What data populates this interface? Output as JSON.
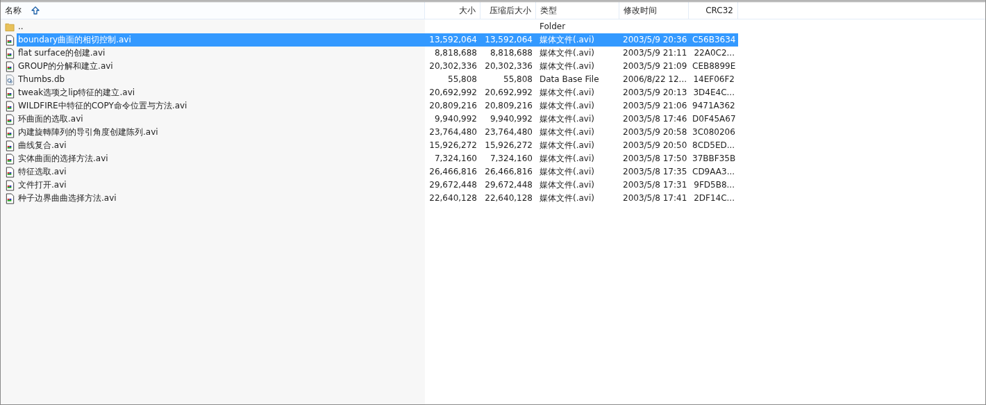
{
  "columns": [
    {
      "label": "名称",
      "sorted": true
    },
    {
      "label": "大小",
      "sorted": false
    },
    {
      "label": "压缩后大小",
      "sorted": false
    },
    {
      "label": "类型",
      "sorted": false
    },
    {
      "label": "修改时间",
      "sorted": false
    },
    {
      "label": "CRC32",
      "sorted": false
    }
  ],
  "rows": [
    {
      "kind": "folder",
      "selected": false,
      "name": "..",
      "size": "",
      "packed": "",
      "type": "Folder",
      "modified": "",
      "crc": ""
    },
    {
      "kind": "video",
      "selected": true,
      "name": "boundary曲面的相切控制.avi",
      "size": "13,592,064",
      "packed": "13,592,064",
      "type": "媒体文件(.avi)",
      "modified": "2003/5/9 20:36",
      "crc": "C56B3634"
    },
    {
      "kind": "video",
      "selected": false,
      "name": "flat surface的创建.avi",
      "size": "8,818,688",
      "packed": "8,818,688",
      "type": "媒体文件(.avi)",
      "modified": "2003/5/9 21:11",
      "crc": "22A0C2..."
    },
    {
      "kind": "video",
      "selected": false,
      "name": "GROUP的分解和建立.avi",
      "size": "20,302,336",
      "packed": "20,302,336",
      "type": "媒体文件(.avi)",
      "modified": "2003/5/9 21:09",
      "crc": "CEB8899E"
    },
    {
      "kind": "database",
      "selected": false,
      "name": "Thumbs.db",
      "size": "55,808",
      "packed": "55,808",
      "type": "Data Base File",
      "modified": "2006/8/22 12...",
      "crc": "14EF06F2"
    },
    {
      "kind": "video",
      "selected": false,
      "name": "tweak选项之lip特征的建立.avi",
      "size": "20,692,992",
      "packed": "20,692,992",
      "type": "媒体文件(.avi)",
      "modified": "2003/5/9 20:13",
      "crc": "3D4E4C..."
    },
    {
      "kind": "video",
      "selected": false,
      "name": "WILDFIRE中特征的COPY命令位置与方法.avi",
      "size": "20,809,216",
      "packed": "20,809,216",
      "type": "媒体文件(.avi)",
      "modified": "2003/5/9 21:06",
      "crc": "9471A362"
    },
    {
      "kind": "video",
      "selected": false,
      "name": "环曲面的选取.avi",
      "size": "9,940,992",
      "packed": "9,940,992",
      "type": "媒体文件(.avi)",
      "modified": "2003/5/8 17:46",
      "crc": "D0F45A67"
    },
    {
      "kind": "video",
      "selected": false,
      "name": "内建旋轉陣列的导引角度创建陈列.avi",
      "size": "23,764,480",
      "packed": "23,764,480",
      "type": "媒体文件(.avi)",
      "modified": "2003/5/9 20:58",
      "crc": "3C080206"
    },
    {
      "kind": "video",
      "selected": false,
      "name": "曲线复合.avi",
      "size": "15,926,272",
      "packed": "15,926,272",
      "type": "媒体文件(.avi)",
      "modified": "2003/5/9 20:50",
      "crc": "8CD5ED..."
    },
    {
      "kind": "video",
      "selected": false,
      "name": "实体曲面的选择方法.avi",
      "size": "7,324,160",
      "packed": "7,324,160",
      "type": "媒体文件(.avi)",
      "modified": "2003/5/8 17:50",
      "crc": "37BBF35B"
    },
    {
      "kind": "video",
      "selected": false,
      "name": "特征选取.avi",
      "size": "26,466,816",
      "packed": "26,466,816",
      "type": "媒体文件(.avi)",
      "modified": "2003/5/8 17:35",
      "crc": "CD9AA3..."
    },
    {
      "kind": "video",
      "selected": false,
      "name": "文件打开.avi",
      "size": "29,672,448",
      "packed": "29,672,448",
      "type": "媒体文件(.avi)",
      "modified": "2003/5/8 17:31",
      "crc": "9FD5B8..."
    },
    {
      "kind": "video",
      "selected": false,
      "name": "种子边界曲曲选择方法.avi",
      "size": "22,640,128",
      "packed": "22,640,128",
      "type": "媒体文件(.avi)",
      "modified": "2003/5/8 17:41",
      "crc": "2DF14C..."
    }
  ]
}
